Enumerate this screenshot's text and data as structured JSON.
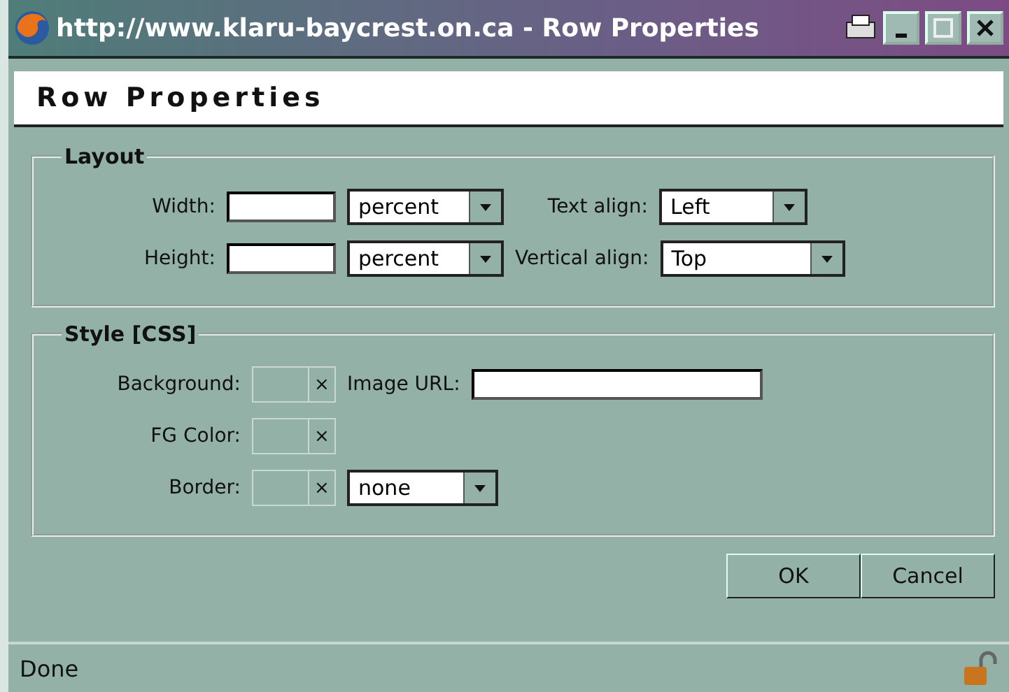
{
  "window": {
    "title": "http://www.klaru-baycrest.on.ca - Row Properties"
  },
  "header": {
    "title": "Row Properties"
  },
  "layout": {
    "legend": "Layout",
    "rows": [
      {
        "label": "Width:",
        "unit": "percent",
        "align_label": "Text align:",
        "align_value": "Left"
      },
      {
        "label": "Height:",
        "unit": "percent",
        "align_label": "Vertical align:",
        "align_value": "Top"
      }
    ]
  },
  "style": {
    "legend": "Style [CSS]",
    "rows": [
      {
        "kind": "color",
        "label": "Background:",
        "clear": "×",
        "extra": {
          "kind": "field",
          "label": "Image URL:"
        }
      },
      {
        "kind": "color",
        "label": "FG Color:",
        "clear": "×"
      },
      {
        "kind": "color",
        "label": "Border:",
        "clear": "×",
        "extra": {
          "kind": "select",
          "value": "none"
        }
      }
    ]
  },
  "buttons": [
    "OK",
    "Cancel"
  ],
  "status_bar": {
    "text": "Done"
  }
}
